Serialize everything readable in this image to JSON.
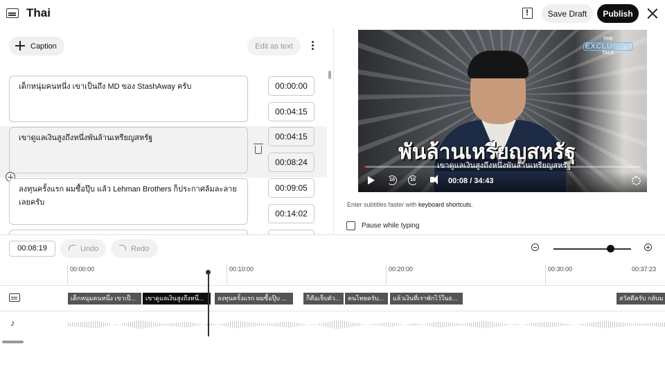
{
  "header": {
    "title": "Thai",
    "save_draft": "Save Draft",
    "publish": "Publish"
  },
  "toolbar": {
    "caption": "Caption",
    "edit_as_text": "Edit as text"
  },
  "captions": [
    {
      "text": "เด็กหนุ่มคนหนึ่ง เขาเป็นถึง MD ของ StashAway ครับ",
      "start": "00:00:00",
      "end": "00:04:15"
    },
    {
      "text": "เขาดูแลเงินสูงถึงหนึ่งพันล้านเหรียญสหรัฐ",
      "start": "00:04:15",
      "end": "00:08:24"
    },
    {
      "text": "ลงทุนครั้งแรก ผมซื้อปุ๊บ แล้ว Lehman Brothers ก็ประกาศล้มละลาย เลยครับ",
      "start": "00:09:05",
      "end": "00:14:02"
    }
  ],
  "video": {
    "logo_top": "THE",
    "logo_main": "EXCLUSIVE",
    "logo_bottom": "TALK",
    "big_text": "พันล้านเหรียญสหรัฐ",
    "subtitle": "เขาดูแลเงินสูงถึงหนึ่งพันล้านเหรียญสหรัฐ",
    "time": "00:08 / 34:43",
    "progress": 0.004,
    "rw_label": "10",
    "ff_label": "10"
  },
  "hint": {
    "prefix": "Enter subtitles faster with ",
    "link": "keyboard shortcuts",
    "suffix": "."
  },
  "pause_label": "Pause while typing",
  "timeline": {
    "current_time": "00:08:19",
    "undo": "Undo",
    "redo": "Redo",
    "ticks": [
      "00:00:00",
      "00:10:00",
      "00:20:00",
      "00:30:00",
      "00:37:23"
    ],
    "segments": [
      {
        "text": "เด็กหนุ่มคนหนึ่ง เขาเป็..."
      },
      {
        "text": "เขาดูแลเงินสูงถึงหนึ่..."
      },
      {
        "text": "ลงทุนครั้งแรก ผมซื้อปุ๊บ ..."
      },
      {
        "text": "ก็คือเจ็บตัว..."
      },
      {
        "text": "คนไทยครับ..."
      },
      {
        "text": "แล้วเงินที่เราพักไว้ในธ..."
      },
      {
        "text": "สวัสดีครับ กลับม"
      }
    ]
  },
  "colors": {
    "publish_bg": "#0f0f0f",
    "progress": "#ff0000",
    "segment": "#545454"
  }
}
